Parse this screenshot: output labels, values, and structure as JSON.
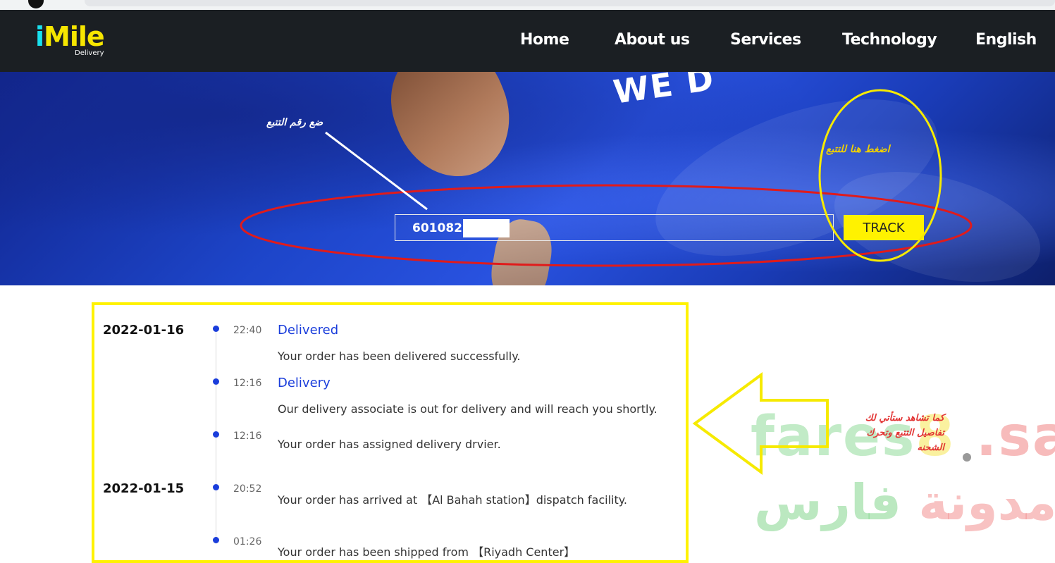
{
  "nav": {
    "logo_main": "Mile",
    "logo_i": "i",
    "logo_sub": "Delivery",
    "links": [
      "Home",
      "About us",
      "Services",
      "Technology",
      "English"
    ]
  },
  "hero": {
    "banner_text": "WE D",
    "tracking_number": "6010822",
    "track_button": "TRACK",
    "annotation_input": "ضع رقم التتبع",
    "annotation_button": "اضغط هنا للتتبع"
  },
  "timeline": {
    "groups": [
      {
        "date": "2022-01-16",
        "events": [
          {
            "time": "22:40",
            "status": "Delivered",
            "detail": "Your order has been delivered successfully."
          },
          {
            "time": "12:16",
            "status": "Delivery",
            "detail": "Our delivery associate is out for delivery and will reach you shortly."
          },
          {
            "time": "12:16",
            "status": "",
            "detail": "Your order has assigned delivery drvier."
          }
        ]
      },
      {
        "date": "2022-01-15",
        "events": [
          {
            "time": "20:52",
            "status": "",
            "detail": "Your order has arrived at 【Al Bahah station】dispatch facility."
          },
          {
            "time": "01:26",
            "status": "",
            "detail": "Your order has been shipped from 【Riyadh Center】"
          }
        ]
      }
    ]
  },
  "callout": {
    "lines": [
      "كما تشاهد ستأتي لك",
      "تفاصيل التتبع وتحرك",
      "الشحنه"
    ]
  },
  "watermark": {
    "latin_name": "fares",
    "latin_num": "8",
    "latin_tld": " .sa",
    "arabic_word1": "مدونة",
    "arabic_word2": "فارس"
  },
  "colors": {
    "nav_bg": "#1b1f23",
    "accent_yellow": "#fff200",
    "status_blue": "#1a3ddb",
    "annotation_red": "#e01b1b"
  }
}
